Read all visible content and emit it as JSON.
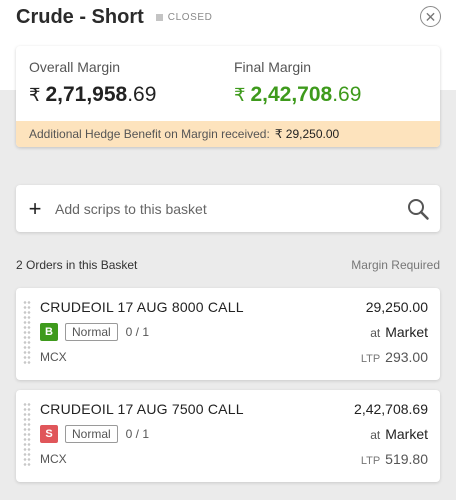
{
  "header": {
    "title": "Crude - Short",
    "status": "CLOSED"
  },
  "margin": {
    "overall_label": "Overall Margin",
    "overall_int": "2,71,958",
    "overall_dec": ".69",
    "final_label": "Final Margin",
    "final_int": "2,42,708",
    "final_dec": ".69",
    "currency_symbol": "₹",
    "hedge_text": "Additional Hedge Benefit on Margin received:",
    "hedge_amount": "₹ 29,250.00"
  },
  "search": {
    "placeholder": "Add scrips to this basket"
  },
  "orders_header": {
    "count_text": "2 Orders in this Basket",
    "margin_required_label": "Margin Required"
  },
  "orders": [
    {
      "instrument": "CRUDEOIL 17 AUG 8000 CALL",
      "side": "B",
      "product": "Normal",
      "qty": "0 / 1",
      "price": "29,250.00",
      "at": "at",
      "order_type": "Market",
      "exchange": "MCX",
      "ltp_label": "LTP",
      "ltp": "293.00"
    },
    {
      "instrument": "CRUDEOIL 17 AUG 7500 CALL",
      "side": "S",
      "product": "Normal",
      "qty": "0 / 1",
      "price": "2,42,708.69",
      "at": "at",
      "order_type": "Market",
      "exchange": "MCX",
      "ltp_label": "LTP",
      "ltp": "519.80"
    }
  ],
  "colors": {
    "buy": "#3e9a1c",
    "sell": "#e0565a",
    "final_margin": "#3e9a1c",
    "hedge_bar": "#fde3bd"
  },
  "icons": {
    "close": "close-icon",
    "add": "plus-icon",
    "search": "search-icon",
    "drag": "drag-handle-icon"
  }
}
